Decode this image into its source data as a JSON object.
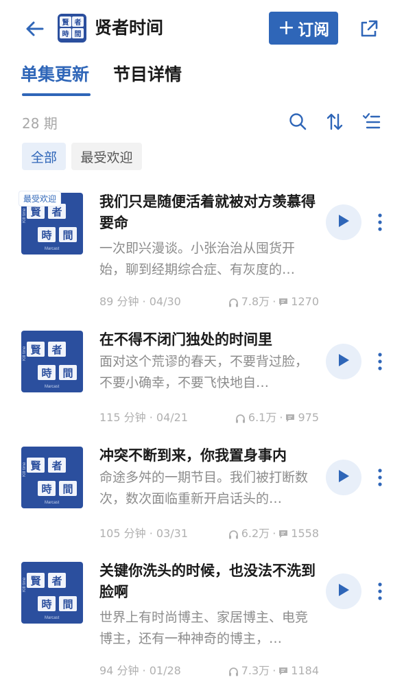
{
  "header": {
    "title": "贤者时间",
    "subscribe_plus": "+",
    "subscribe_label": "订阅"
  },
  "tabs": [
    {
      "label": "单集更新",
      "active": true
    },
    {
      "label": "节目详情",
      "active": false
    }
  ],
  "toolbar": {
    "count": "28 期",
    "icons": [
      "search-icon",
      "sort-icon",
      "filter-list-icon"
    ]
  },
  "filters": {
    "all": "全部",
    "popular": "最受欢迎"
  },
  "logo": {
    "chars": [
      "賢",
      "者",
      "時",
      "間"
    ],
    "tag_side": "KIll time",
    "tag_bottom": "Marcast"
  },
  "episodes": [
    {
      "badge": "最受欢迎",
      "title": "我们只是随便活着就被对方羡慕得要命",
      "desc": "一次即兴漫谈。小张治治从囤货开始，聊到经期综合症、有灰度的…",
      "duration_date": "89 分钟 · 04/30",
      "plays": "7.8万",
      "comments": "1270"
    },
    {
      "badge": "",
      "title": "在不得不闭门独处的时间里",
      "desc": "面对这个荒谬的春天，不要背过脸，不要小确幸，不要飞快地自…",
      "duration_date": "115 分钟 · 04/21",
      "plays": "6.1万",
      "comments": "975"
    },
    {
      "badge": "",
      "title": "冲突不断到来，你我置身事内",
      "desc": "命途多舛的一期节目。我们被打断数次，数次面临重新开启话头的…",
      "duration_date": "105 分钟 · 03/31",
      "plays": "6.2万",
      "comments": "1558"
    },
    {
      "badge": "",
      "title": "关键你洗头的时候，也没法不洗到脸啊",
      "desc": "世界上有时尚博主、家居博主、电竞博主，还有一种神奇的博主，…",
      "duration_date": "94 分钟 · 01/28",
      "plays": "7.3万",
      "comments": "1184"
    }
  ],
  "colors": {
    "accent": "#2f66b8",
    "accent_light": "#e8eff9",
    "logo_bg": "#2b4f9e",
    "muted": "#8c8c8c"
  }
}
